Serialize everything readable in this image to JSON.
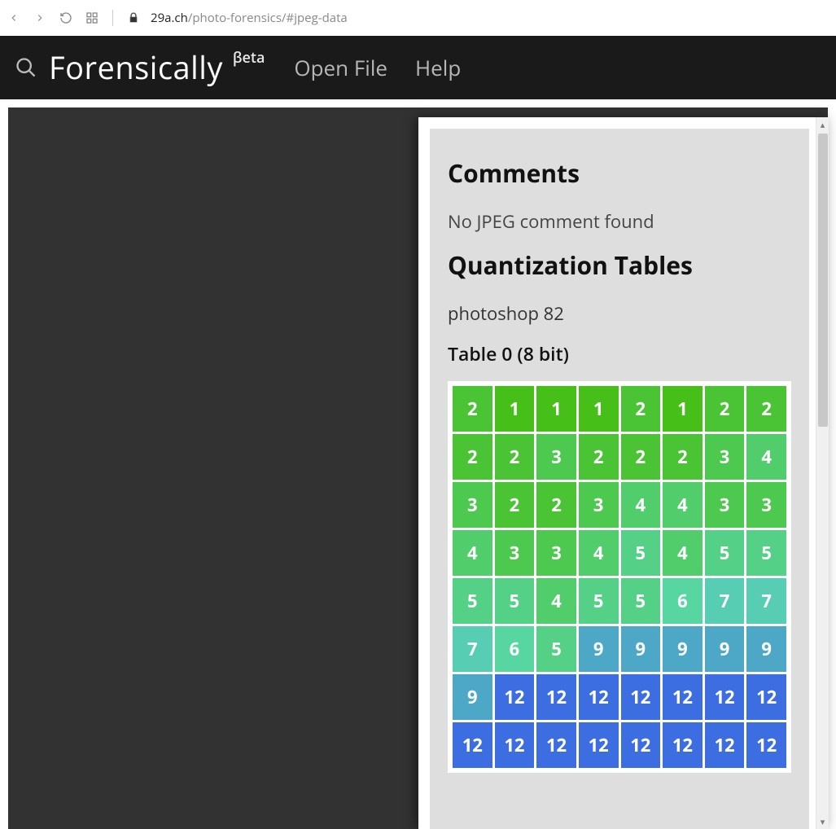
{
  "browser": {
    "url_host": "29a.ch",
    "url_path": "/photo-forensics/#jpeg-data"
  },
  "header": {
    "brand_name": "Forensically",
    "brand_badge": "βeta",
    "menu": {
      "open_file": "Open File",
      "help": "Help"
    }
  },
  "panel": {
    "comments": {
      "title": "Comments",
      "message": "No JPEG comment found"
    },
    "quant": {
      "title": "Quantization Tables",
      "detector": "photoshop 82",
      "table_label": "Table 0 (8 bit)",
      "rows": [
        [
          2,
          1,
          1,
          1,
          2,
          1,
          2,
          2
        ],
        [
          2,
          2,
          3,
          2,
          2,
          2,
          3,
          4
        ],
        [
          3,
          2,
          2,
          3,
          4,
          4,
          3,
          3
        ],
        [
          4,
          3,
          3,
          4,
          5,
          4,
          5,
          5
        ],
        [
          5,
          5,
          4,
          5,
          5,
          6,
          7,
          7
        ],
        [
          7,
          6,
          5,
          9,
          9,
          9,
          9,
          9
        ],
        [
          9,
          12,
          12,
          12,
          12,
          12,
          12,
          12
        ],
        [
          12,
          12,
          12,
          12,
          12,
          12,
          12,
          12
        ]
      ]
    }
  }
}
